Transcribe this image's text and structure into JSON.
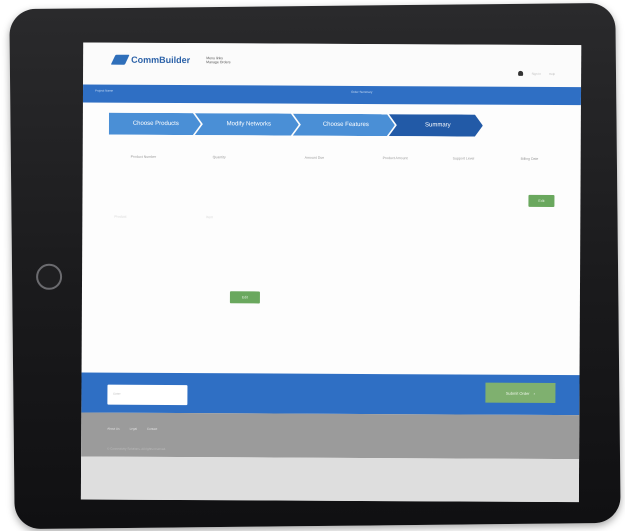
{
  "header": {
    "logo_text": "CommBuilder",
    "logo_sub_line1": "Menu links",
    "logo_sub_line2": "Manage Orders",
    "links": [
      "Sign In",
      "Help"
    ]
  },
  "blue_bar": {
    "left_text": "Project Name",
    "right_text": "Order Summary"
  },
  "stepper": {
    "steps": [
      "Choose Products",
      "Modify Networks",
      "Choose Features",
      "Summary"
    ],
    "active_index": 3
  },
  "table": {
    "columns": [
      "Product Number",
      "Quantity",
      "Amount Due",
      "Product Amount",
      "Support Level",
      "Billing Date"
    ],
    "ghost_rows": [
      "Product",
      "Item"
    ]
  },
  "buttons": {
    "top_right": "Edit",
    "middle": "Edit"
  },
  "footer_band": {
    "input_placeholder": "Enter",
    "cta_label": "Submit Order",
    "cta_arrow": "›"
  },
  "gray_footer": {
    "links": [
      "About Us",
      "Legal",
      "Contact"
    ],
    "copyright": "© Connectivity Solutions. All rights reserved."
  },
  "colors": {
    "brand_blue": "#2f6fc4",
    "step_blue": "#4a8fd6",
    "step_active": "#225aa7",
    "button_green": "#6aa85e",
    "footer_gray": "#9b9b9b"
  }
}
